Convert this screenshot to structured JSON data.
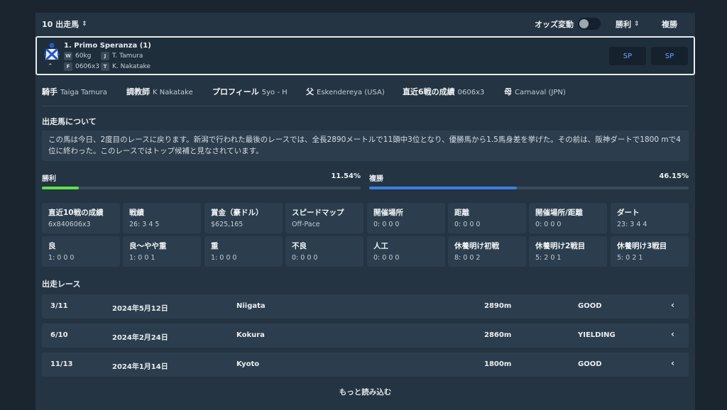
{
  "header": {
    "runners_label": "10 出走馬",
    "odds_label": "オッズ変動",
    "win_label": "勝利",
    "place_label": "複勝"
  },
  "horse": {
    "name": "1. Primo Speranza (1)",
    "weight_tag": "W",
    "weight": "60kg",
    "jockey_tag": "J",
    "jockey": "T. Tamura",
    "form_tag": "F",
    "form": "0606x3",
    "trainer_tag": "T",
    "trainer": "K. Nakatake",
    "sp1": "SP",
    "sp2": "SP"
  },
  "info": {
    "jockey_label": "騎手",
    "jockey_value": "Taiga Tamura",
    "trainer_label": "調教師",
    "trainer_value": "K Nakatake",
    "profile_label": "プロフィール",
    "profile_value": "5yo - H",
    "sire_label": "父",
    "sire_value": "Eskendereya (USA)",
    "recent_label": "直近6戦の成績",
    "recent_value": "0606x3",
    "dam_label": "母",
    "dam_value": "Carnaval (JPN)"
  },
  "about": {
    "title": "出走馬について",
    "text": "この馬は今日、2度目のレースに戻ります。新潟で行われた最後のレースでは、全長2890メートルで11頭中3位となり、優勝馬から1.5馬身差を挙げた。その前は、阪神ダートで1800 mで4位に終わった。このレースではトップ候補と見なされています。"
  },
  "bars": {
    "win_label": "勝利",
    "win_value": "11.54%",
    "win_fraction": 0.1154,
    "place_label": "複勝",
    "place_value": "46.15%",
    "place_fraction": 0.4615,
    "win_color": "#5ee04a",
    "place_color": "#3b7fe0"
  },
  "stats": [
    {
      "title": "直近10戦の成績",
      "value": "6x840606x3"
    },
    {
      "title": "戦績",
      "value": "26: 3 4 5"
    },
    {
      "title": "賞金（豪ドル）",
      "value": "$625,165"
    },
    {
      "title": "スピードマップ",
      "value": "Off-Pace"
    },
    {
      "title": "開催場所",
      "value": "0: 0 0 0"
    },
    {
      "title": "距離",
      "value": "0: 0 0 0"
    },
    {
      "title": "開催場所/距離",
      "value": "0: 0 0 0"
    },
    {
      "title": "ダート",
      "value": "23: 3 4 4"
    },
    {
      "title": "良",
      "value": "1: 0 0 0"
    },
    {
      "title": "良〜やや重",
      "value": "1: 0 0 1"
    },
    {
      "title": "重",
      "value": "1: 0 0 0"
    },
    {
      "title": "不良",
      "value": "0: 0 0 0"
    },
    {
      "title": "人工",
      "value": "0: 0 0 0"
    },
    {
      "title": "休養明け初戦",
      "value": "8: 0 0 2"
    },
    {
      "title": "休養明け2戦目",
      "value": "5: 2 0 1"
    },
    {
      "title": "休養明け3戦目",
      "value": "5: 0 2 1"
    }
  ],
  "races": {
    "title": "出走レース",
    "rows": [
      {
        "pos": "3/11",
        "date": "2024年5月12日",
        "venue": "Niigata",
        "dist": "2890m",
        "going": "GOOD"
      },
      {
        "pos": "6/10",
        "date": "2024年2月24日",
        "venue": "Kokura",
        "dist": "2860m",
        "going": "YIELDING"
      },
      {
        "pos": "11/13",
        "date": "2024年1月14日",
        "venue": "Kyoto",
        "dist": "1800m",
        "going": "GOOD"
      }
    ],
    "more_label": "もっと読み込む"
  }
}
